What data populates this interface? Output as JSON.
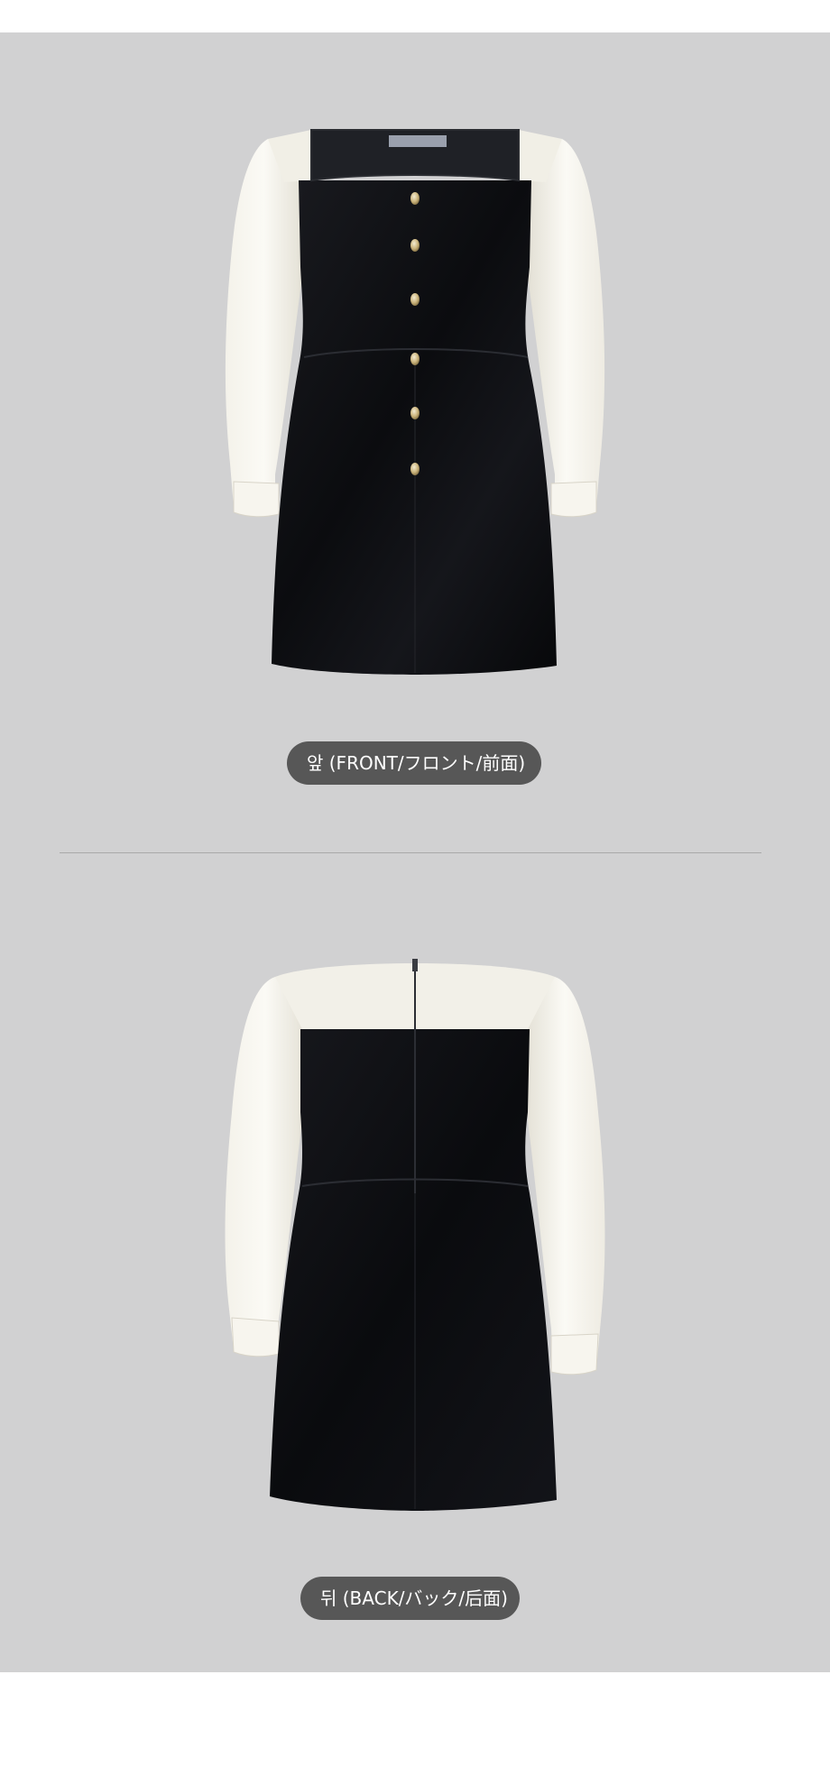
{
  "colors": {
    "panel_background": "#d1d1d2",
    "caption_pill": "#575757",
    "caption_text": "#ffffff",
    "divider": "#a9a9a9",
    "velvet": "#0d0e11",
    "satin": "#f3f1ea",
    "button_gold": "#c9b27a"
  },
  "views": [
    {
      "caption": "앞 (FRONT/フロント/前面)",
      "image": "dress-front-photo"
    },
    {
      "caption": "뒤 (BACK/バック/后面)",
      "image": "dress-back-photo"
    }
  ]
}
